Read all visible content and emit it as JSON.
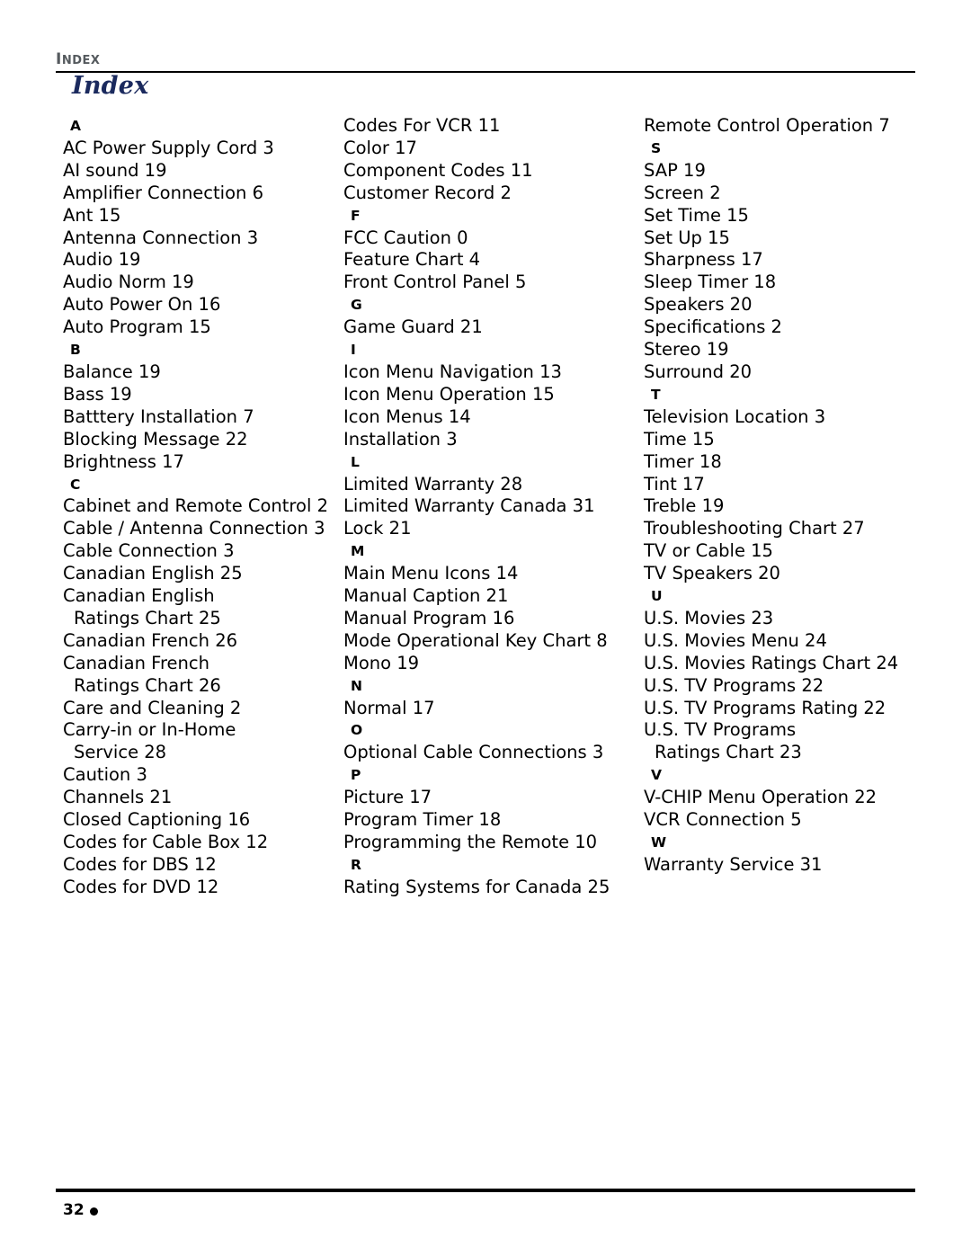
{
  "header": {
    "kicker_cap": "I",
    "kicker_rest": "NDEX",
    "title": "Index"
  },
  "columns": [
    {
      "items": [
        {
          "type": "letter",
          "text": "A"
        },
        {
          "type": "entry",
          "text": "AC Power Supply Cord 3"
        },
        {
          "type": "entry",
          "text": "AI sound 19"
        },
        {
          "type": "entry",
          "text": "Amplifier Connection 6"
        },
        {
          "type": "entry",
          "text": "Ant 15"
        },
        {
          "type": "entry",
          "text": "Antenna Connection 3"
        },
        {
          "type": "entry",
          "text": "Audio 19"
        },
        {
          "type": "entry",
          "text": "Audio Norm 19"
        },
        {
          "type": "entry",
          "text": "Auto Power On 16"
        },
        {
          "type": "entry",
          "text": "Auto Program 15"
        },
        {
          "type": "letter",
          "text": "B"
        },
        {
          "type": "entry",
          "text": "Balance 19"
        },
        {
          "type": "entry",
          "text": "Bass 19"
        },
        {
          "type": "entry",
          "text": "Batttery Installation 7"
        },
        {
          "type": "entry",
          "text": "Blocking Message 22"
        },
        {
          "type": "entry",
          "text": "Brightness 17"
        },
        {
          "type": "letter",
          "text": "C"
        },
        {
          "type": "entry",
          "text": "Cabinet and Remote Control 2"
        },
        {
          "type": "entry",
          "text": "Cable / Antenna Connection 3"
        },
        {
          "type": "entry",
          "text": "Cable Connection 3"
        },
        {
          "type": "entry",
          "text": "Canadian English 25"
        },
        {
          "type": "entry",
          "text": "Canadian English"
        },
        {
          "type": "cont",
          "text": "Ratings Chart 25"
        },
        {
          "type": "entry",
          "text": "Canadian French 26"
        },
        {
          "type": "entry",
          "text": "Canadian French"
        },
        {
          "type": "cont",
          "text": "Ratings Chart 26"
        },
        {
          "type": "entry",
          "text": "Care and Cleaning 2"
        },
        {
          "type": "entry",
          "text": "Carry-in or In-Home"
        },
        {
          "type": "cont",
          "text": "Service 28"
        },
        {
          "type": "entry",
          "text": "Caution 3"
        },
        {
          "type": "entry",
          "text": "Channels 21"
        },
        {
          "type": "entry",
          "text": "Closed Captioning 16"
        },
        {
          "type": "entry",
          "text": "Codes for Cable Box 12"
        },
        {
          "type": "entry",
          "text": "Codes for DBS 12"
        },
        {
          "type": "entry",
          "text": "Codes for DVD 12"
        }
      ]
    },
    {
      "items": [
        {
          "type": "entry",
          "text": "Codes For VCR 11"
        },
        {
          "type": "entry",
          "text": "Color 17"
        },
        {
          "type": "entry",
          "text": "Component Codes 11"
        },
        {
          "type": "entry",
          "text": "Customer Record 2"
        },
        {
          "type": "letter",
          "text": "F"
        },
        {
          "type": "entry",
          "text": "FCC Caution 0"
        },
        {
          "type": "entry",
          "text": "Feature Chart 4"
        },
        {
          "type": "entry",
          "text": "Front Control Panel 5"
        },
        {
          "type": "letter",
          "text": "G"
        },
        {
          "type": "entry",
          "text": "Game Guard 21"
        },
        {
          "type": "letter",
          "text": "I"
        },
        {
          "type": "entry",
          "text": "Icon Menu Navigation 13"
        },
        {
          "type": "entry",
          "text": "Icon Menu Operation 15"
        },
        {
          "type": "entry",
          "text": "Icon Menus 14"
        },
        {
          "type": "entry",
          "text": "Installation 3"
        },
        {
          "type": "letter",
          "text": "L"
        },
        {
          "type": "entry",
          "text": "Limited Warranty 28"
        },
        {
          "type": "entry",
          "text": "Limited Warranty Canada 31"
        },
        {
          "type": "entry",
          "text": "Lock 21"
        },
        {
          "type": "letter",
          "text": "M"
        },
        {
          "type": "entry",
          "text": "Main Menu Icons 14"
        },
        {
          "type": "entry",
          "text": "Manual Caption 21"
        },
        {
          "type": "entry",
          "text": "Manual Program 16"
        },
        {
          "type": "entry",
          "text": "Mode Operational Key Chart 8"
        },
        {
          "type": "entry",
          "text": "Mono 19"
        },
        {
          "type": "letter",
          "text": "N"
        },
        {
          "type": "entry",
          "text": "Normal 17"
        },
        {
          "type": "letter",
          "text": "O"
        },
        {
          "type": "entry",
          "text": "Optional Cable Connections 3"
        },
        {
          "type": "letter",
          "text": "P"
        },
        {
          "type": "entry",
          "text": "Picture 17"
        },
        {
          "type": "entry",
          "text": "Program Timer 18"
        },
        {
          "type": "entry",
          "text": "Programming the Remote 10"
        },
        {
          "type": "letter",
          "text": "R"
        },
        {
          "type": "entry",
          "text": "Rating Systems for Canada 25"
        }
      ]
    },
    {
      "items": [
        {
          "type": "entry",
          "text": "Remote Control Operation 7"
        },
        {
          "type": "letter",
          "text": "S"
        },
        {
          "type": "entry",
          "text": "SAP 19"
        },
        {
          "type": "entry",
          "text": "Screen 2"
        },
        {
          "type": "entry",
          "text": "Set Time 15"
        },
        {
          "type": "entry",
          "text": "Set Up 15"
        },
        {
          "type": "entry",
          "text": "Sharpness 17"
        },
        {
          "type": "entry",
          "text": "Sleep Timer 18"
        },
        {
          "type": "entry",
          "text": "Speakers 20"
        },
        {
          "type": "entry",
          "text": "Specifications 2"
        },
        {
          "type": "entry",
          "text": "Stereo 19"
        },
        {
          "type": "entry",
          "text": "Surround 20"
        },
        {
          "type": "letter",
          "text": "T"
        },
        {
          "type": "entry",
          "text": "Television Location 3"
        },
        {
          "type": "entry",
          "text": "Time 15"
        },
        {
          "type": "entry",
          "text": "Timer 18"
        },
        {
          "type": "entry",
          "text": "Tint 17"
        },
        {
          "type": "entry",
          "text": "Treble 19"
        },
        {
          "type": "entry",
          "text": "Troubleshooting Chart 27"
        },
        {
          "type": "entry",
          "text": "TV or Cable 15"
        },
        {
          "type": "entry",
          "text": "TV Speakers 20"
        },
        {
          "type": "letter",
          "text": "U"
        },
        {
          "type": "entry",
          "text": "U.S. Movies 23"
        },
        {
          "type": "entry",
          "text": "U.S. Movies Menu 24"
        },
        {
          "type": "entry",
          "text": "U.S. Movies Ratings Chart 24"
        },
        {
          "type": "entry",
          "text": "U.S. TV Programs 22"
        },
        {
          "type": "entry",
          "text": "U.S. TV Programs Rating 22"
        },
        {
          "type": "entry",
          "text": "U.S. TV Programs"
        },
        {
          "type": "cont",
          "text": "Ratings Chart 23"
        },
        {
          "type": "letter",
          "text": "V"
        },
        {
          "type": "entry",
          "text": "V-CHIP Menu Operation 22"
        },
        {
          "type": "entry",
          "text": "VCR Connection 5"
        },
        {
          "type": "letter",
          "text": "W"
        },
        {
          "type": "entry",
          "text": "Warranty Service 31"
        }
      ]
    }
  ],
  "footer": {
    "page_number": "32",
    "bullet_icon": "filled-circle-icon"
  }
}
